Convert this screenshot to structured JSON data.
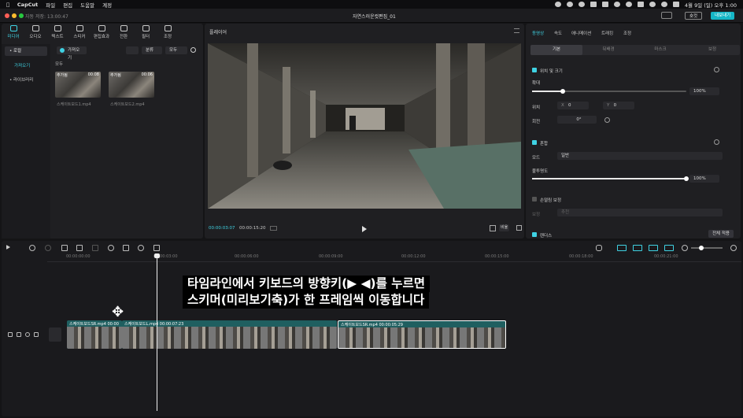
{
  "menubar": {
    "app": "CapCut",
    "items": [
      "파일",
      "편집",
      "도움말",
      "계정"
    ],
    "datetime": "4월 9일 (일) 오후 1:00"
  },
  "titlebar": {
    "autosave": "자동 저장: 13:00:47",
    "project": "자연스러운컷편집_01",
    "shortcut_label": "숏컷",
    "export_label": "내보내기"
  },
  "media": {
    "tabs": [
      "미디어",
      "오디오",
      "텍스트",
      "스티커",
      "편집효과",
      "전환",
      "필터",
      "조정"
    ],
    "active_tab": 0,
    "side": [
      "• 로컬",
      "가져오기",
      "• 라이브러리"
    ],
    "import_label": "가져오기",
    "sort_label": "분류",
    "all_label": "모두",
    "section_label": "모두",
    "clips": [
      {
        "tag": "추가됨",
        "duration": "00:08",
        "name": "스케이트보드1.mp4"
      },
      {
        "tag": "추가됨",
        "duration": "00:06",
        "name": "스케이트보드2.mp4"
      }
    ]
  },
  "player": {
    "title": "플레이어",
    "current_time": "00:00:03:07",
    "total_time": "00:00:15:20",
    "ratio_label": "비율"
  },
  "inspector": {
    "tabs": [
      "동영상",
      "속도",
      "애니메이션",
      "트래킹",
      "조정"
    ],
    "active_tab": 0,
    "segments": [
      "기본",
      "뒤배경",
      "마스크",
      "보정"
    ],
    "position_size": "위치 및 크기",
    "scale_label": "확대",
    "scale_value": "100%",
    "scale_fraction": 0.2,
    "pos_label": "위치",
    "x_label": "X",
    "x_value": "0",
    "y_label": "Y",
    "y_value": "0",
    "rotate_label": "회전",
    "rotate_value": "0°",
    "blend_label": "혼합",
    "mode_label": "모드",
    "mode_value": "일반",
    "opacity_label": "불투명도",
    "opacity_value": "100%",
    "opacity_fraction": 1.0,
    "stabilize_label": "손떨림 보정",
    "stabilize_sub_label": "보정",
    "stabilize_sub_value": "추천",
    "render_label": "렌더스",
    "apply_all_label": "전체 적용"
  },
  "timeline": {
    "ruler": [
      "00:00:00:00",
      "00:00:03:00",
      "00:00:06:00",
      "00:00:09:00",
      "00:00:12:00",
      "00:00:15:00",
      "00:00:18:00",
      "00:00:21:00"
    ],
    "clips": [
      {
        "label": "스케이트보드SR.mp4  00:00"
      },
      {
        "label": "스케이트보드L.mp4  00:00:07:23"
      },
      {
        "label": "스케이트보드SR.mp4  00:00:05:29"
      }
    ],
    "caption_line1": "타임라인에서 키보드의 방향키(▶ ◀)를 누르면",
    "caption_line2": "스키머(미리보기축)가 한 프레임씩 이동합니다"
  }
}
